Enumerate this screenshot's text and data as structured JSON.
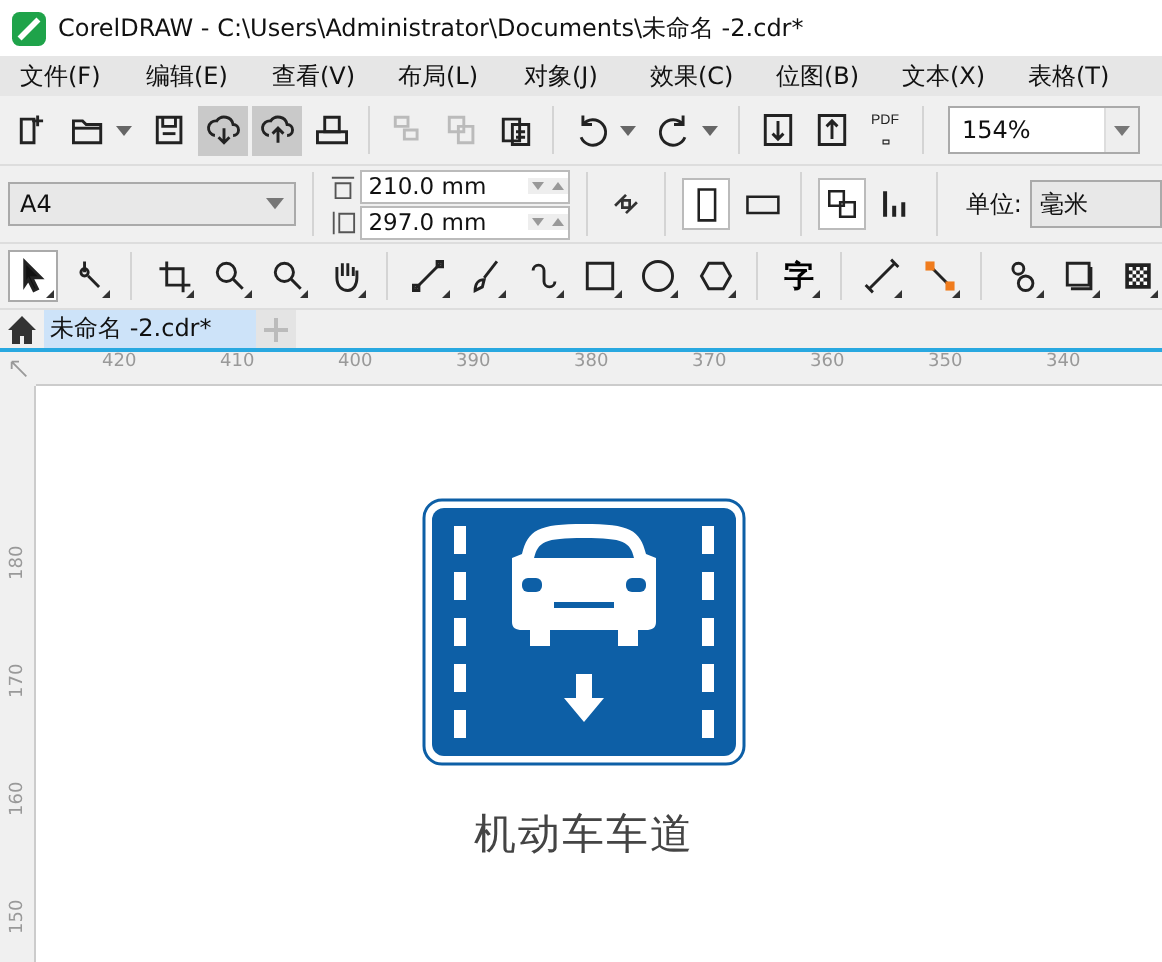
{
  "window": {
    "title": "CorelDRAW - C:\\Users\\Administrator\\Documents\\未命名 -2.cdr*"
  },
  "menu": [
    "文件(F)",
    "编辑(E)",
    "查看(V)",
    "布局(L)",
    "对象(J)",
    "效果(C)",
    "位图(B)",
    "文本(X)",
    "表格(T)"
  ],
  "toolbar": {
    "items": [
      {
        "selected": false,
        "disabled": false
      },
      {
        "selected": false,
        "disabled": false
      },
      {
        "selected": false,
        "disabled": false
      },
      {
        "selected": true,
        "disabled": false
      },
      {
        "selected": true,
        "disabled": false
      },
      {
        "selected": false,
        "disabled": false
      },
      {
        "selected": false,
        "disabled": true
      },
      {
        "selected": false,
        "disabled": true
      },
      {
        "selected": false,
        "disabled": false
      },
      {
        "selected": false,
        "disabled": false
      },
      {
        "selected": false,
        "disabled": false
      },
      {
        "selected": false,
        "disabled": false
      },
      {
        "selected": false,
        "disabled": false
      },
      {
        "selected": false,
        "disabled": false,
        "label": "PDF"
      }
    ],
    "zoom": "154%"
  },
  "property_bar": {
    "page_size": "A4",
    "width": "210.0 mm",
    "height": "297.0 mm",
    "orientation_portrait": true,
    "units_label": "单位:",
    "units": "毫米"
  },
  "toolbox": [
    {
      "selected": true
    },
    {
      "selected": false
    },
    {
      "selected": false
    },
    {
      "selected": false
    },
    {
      "selected": false
    },
    {
      "selected": false
    },
    {
      "selected": false
    },
    {
      "selected": false
    },
    {
      "selected": false
    },
    {
      "selected": false
    },
    {
      "selected": false
    },
    {
      "selected": false
    },
    {
      "selected": false,
      "label": "字"
    },
    {
      "selected": false
    },
    {
      "selected": false
    },
    {
      "selected": false
    },
    {
      "selected": false
    },
    {
      "selected": false
    }
  ],
  "tabs": [
    {
      "label": "未命名 -2.cdr*",
      "selected": true
    }
  ],
  "ruler": {
    "horizontal": [
      "420",
      "410",
      "400",
      "390",
      "380",
      "370",
      "360",
      "350",
      "340"
    ],
    "vertical": [
      "180",
      "170",
      "160",
      "150"
    ]
  },
  "canvas": {
    "caption": "机动车车道"
  }
}
